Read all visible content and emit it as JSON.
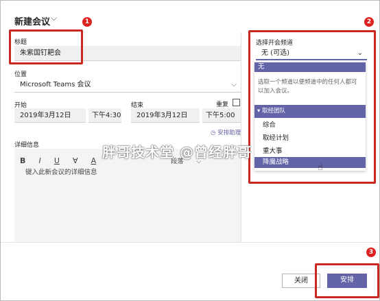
{
  "header": {
    "title": "新建会议"
  },
  "badges": [
    "1",
    "2",
    "3"
  ],
  "form": {
    "title_label": "标题",
    "title_value": "朱紫国钉耙会",
    "location_label": "位置",
    "location_value": "Microsoft Teams 会议",
    "start_label": "开始",
    "start_date": "2019年3月12日",
    "start_time": "下午4:30",
    "end_label": "结束",
    "end_date": "2019年3月12日",
    "end_time": "下午5:00",
    "repeat_label": "重复",
    "schedule_helper": "安排助理",
    "details_label": "详细信息",
    "details_placeholder": "键入此新会议的详细信息",
    "toolbar": {
      "bold": "B",
      "italic": "I",
      "underline": "U",
      "strike": "∀",
      "font_color": "A",
      "style_label": "段落"
    }
  },
  "channel": {
    "label": "选择开会频道",
    "selected": "无 (可选)",
    "options": {
      "none": "无",
      "hint": "选取一个频道以便频道中的任何人都可以加入会议。",
      "team": "取经团队",
      "items": [
        "综合",
        "取经计划",
        "重大事",
        "降魔战略"
      ]
    }
  },
  "footer": {
    "close_label": "关闭",
    "schedule_label": "安排"
  },
  "watermark": "胖哥技术堂 @曾经胖哥",
  "colors": {
    "accent": "#6264a7",
    "highlight": "#c8281f"
  }
}
